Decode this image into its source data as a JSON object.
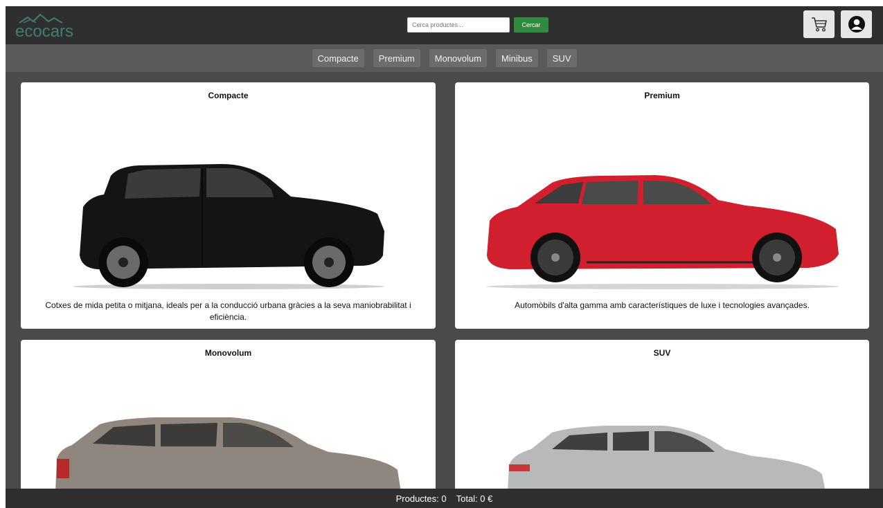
{
  "header": {
    "logo_text": "ecocars",
    "search_placeholder": "Cerca productes...",
    "search_button": "Cercar",
    "cart_icon": "cart-icon",
    "user_icon": "user-icon"
  },
  "nav": {
    "categories": [
      "Compacte",
      "Premium",
      "Monovolum",
      "Minibus",
      "SUV"
    ]
  },
  "cards": [
    {
      "title": "Compacte",
      "description": "Cotxes de mida petita o mitjana, ideals per a la conducció urbana gràcies a la seva maniobrabilitat i eficiència.",
      "car_color": "#141414"
    },
    {
      "title": "Premium",
      "description": "Automòbils d'alta gamma amb característiques de luxe i tecnologies avançades.",
      "car_color": "#d21f2d"
    },
    {
      "title": "Monovolum",
      "description": "",
      "car_color": "#8f877f"
    },
    {
      "title": "SUV",
      "description": "",
      "car_color": "#b8b9bb"
    }
  ],
  "footer": {
    "products_text": "Productes: 0",
    "total_text": "Total: 0 €"
  },
  "colors": {
    "header_bg": "#2f2f2f",
    "nav_bg": "#5a5a5a",
    "page_bg": "#4a4a4a",
    "accent_green": "#2e8b3f"
  }
}
